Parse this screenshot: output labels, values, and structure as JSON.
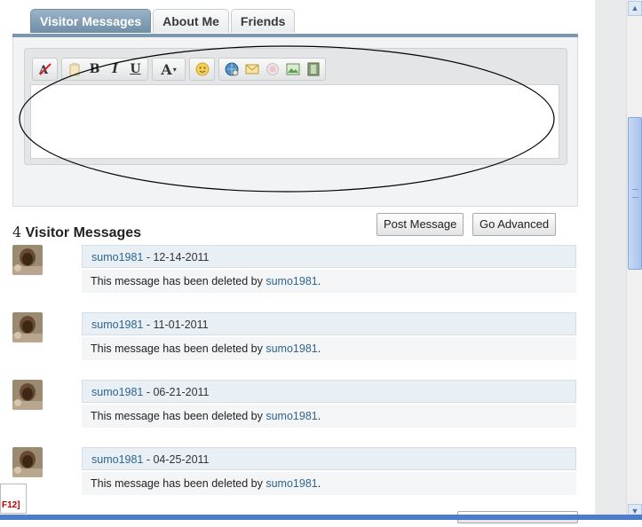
{
  "tabs": [
    {
      "label": "Visitor Messages",
      "active": true
    },
    {
      "label": "About Me",
      "active": false
    },
    {
      "label": "Friends",
      "active": false
    }
  ],
  "editor": {
    "toolbar_icons": [
      "remove-format-icon",
      "paste-icon",
      "bold-icon",
      "italic-icon",
      "underline-icon",
      "font-size-icon",
      "smilie-icon",
      "link-icon",
      "email-icon",
      "quote-icon",
      "image-icon",
      "video-icon"
    ],
    "bold": "B",
    "italic": "I",
    "underline": "U",
    "fontsize": "A",
    "textarea_value": ""
  },
  "buttons": {
    "post": "Post Message",
    "advanced": "Go Advanced"
  },
  "messages_heading": {
    "count": "4",
    "label": "Visitor Messages"
  },
  "messages": [
    {
      "user": "sumo1981",
      "date": "12-14-2011",
      "body": "This message has been deleted by",
      "deleted_by": "sumo1981"
    },
    {
      "user": "sumo1981",
      "date": "11-01-2011",
      "body": "This message has been deleted by",
      "deleted_by": "sumo1981"
    },
    {
      "user": "sumo1981",
      "date": "06-21-2011",
      "body": "This message has been deleted by",
      "deleted_by": "sumo1981"
    },
    {
      "user": "sumo1981",
      "date": "04-25-2011",
      "body": "This message has been deleted by",
      "deleted_by": "sumo1981"
    }
  ],
  "separator": " - ",
  "period": ".",
  "devtools_label": "F12]",
  "colors": {
    "tab_active": "#7d98ae",
    "link": "#2f6590",
    "annotation": "#000000"
  }
}
